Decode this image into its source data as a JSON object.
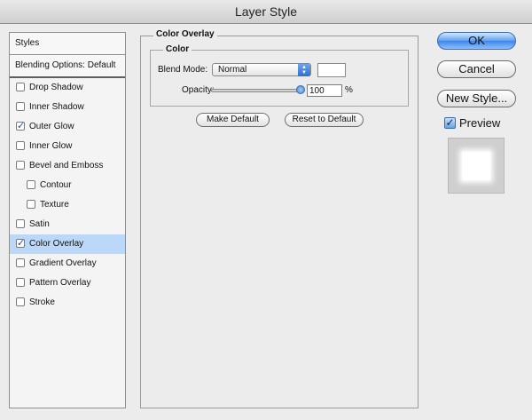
{
  "window": {
    "title": "Layer Style"
  },
  "sidebar": {
    "header": "Styles",
    "blending": "Blending Options: Default",
    "items": [
      {
        "label": "Drop Shadow",
        "checked": false,
        "sub": false,
        "selected": false
      },
      {
        "label": "Inner Shadow",
        "checked": false,
        "sub": false,
        "selected": false
      },
      {
        "label": "Outer Glow",
        "checked": true,
        "sub": false,
        "selected": false
      },
      {
        "label": "Inner Glow",
        "checked": false,
        "sub": false,
        "selected": false
      },
      {
        "label": "Bevel and Emboss",
        "checked": false,
        "sub": false,
        "selected": false
      },
      {
        "label": "Contour",
        "checked": false,
        "sub": true,
        "selected": false
      },
      {
        "label": "Texture",
        "checked": false,
        "sub": true,
        "selected": false
      },
      {
        "label": "Satin",
        "checked": false,
        "sub": false,
        "selected": false
      },
      {
        "label": "Color Overlay",
        "checked": true,
        "sub": false,
        "selected": true
      },
      {
        "label": "Gradient Overlay",
        "checked": false,
        "sub": false,
        "selected": false
      },
      {
        "label": "Pattern Overlay",
        "checked": false,
        "sub": false,
        "selected": false
      },
      {
        "label": "Stroke",
        "checked": false,
        "sub": false,
        "selected": false
      }
    ]
  },
  "panel": {
    "title": "Color Overlay",
    "group": "Color",
    "blend_mode_label": "Blend Mode:",
    "blend_mode_value": "Normal",
    "swatch_color": "#ffffff",
    "opacity_label": "Opacity:",
    "opacity_value": "100",
    "opacity_unit": "%",
    "make_default": "Make Default",
    "reset_default": "Reset to Default"
  },
  "buttons": {
    "ok": "OK",
    "cancel": "Cancel",
    "new_style": "New Style..."
  },
  "preview": {
    "label": "Preview",
    "checked": true
  },
  "icons": {
    "check": "✓",
    "select_arrows": "up-down-arrows-icon"
  }
}
